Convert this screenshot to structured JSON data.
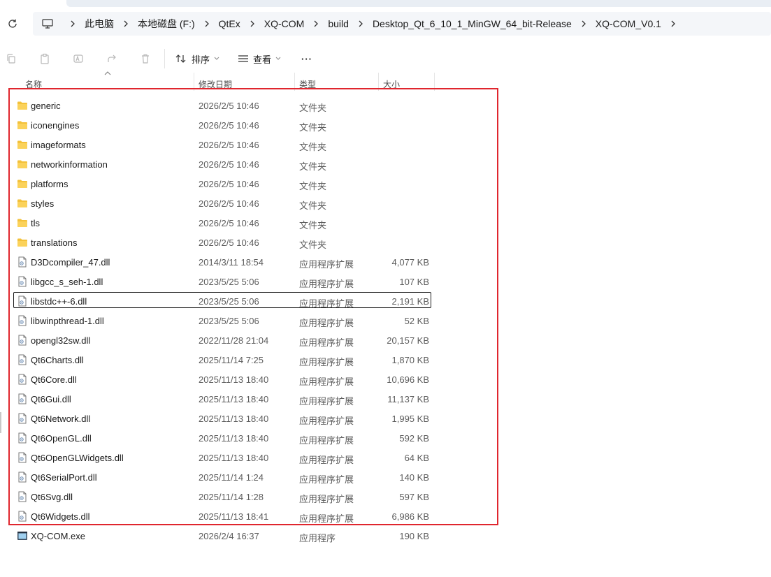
{
  "breadcrumb": [
    "此电脑",
    "本地磁盘 (F:)",
    "QtEx",
    "XQ-COM",
    "build",
    "Desktop_Qt_6_10_1_MinGW_64_bit-Release",
    "XQ-COM_V0.1"
  ],
  "toolbar": {
    "sort_label": "排序",
    "view_label": "查看",
    "more_label": "···"
  },
  "columns": {
    "name": "名称",
    "date": "修改日期",
    "type": "类型",
    "size": "大小"
  },
  "files": [
    {
      "name": "generic",
      "date": "2026/2/5 10:46",
      "type": "文件夹",
      "size": "",
      "kind": "folder"
    },
    {
      "name": "iconengines",
      "date": "2026/2/5 10:46",
      "type": "文件夹",
      "size": "",
      "kind": "folder"
    },
    {
      "name": "imageformats",
      "date": "2026/2/5 10:46",
      "type": "文件夹",
      "size": "",
      "kind": "folder"
    },
    {
      "name": "networkinformation",
      "date": "2026/2/5 10:46",
      "type": "文件夹",
      "size": "",
      "kind": "folder"
    },
    {
      "name": "platforms",
      "date": "2026/2/5 10:46",
      "type": "文件夹",
      "size": "",
      "kind": "folder"
    },
    {
      "name": "styles",
      "date": "2026/2/5 10:46",
      "type": "文件夹",
      "size": "",
      "kind": "folder"
    },
    {
      "name": "tls",
      "date": "2026/2/5 10:46",
      "type": "文件夹",
      "size": "",
      "kind": "folder"
    },
    {
      "name": "translations",
      "date": "2026/2/5 10:46",
      "type": "文件夹",
      "size": "",
      "kind": "folder"
    },
    {
      "name": "D3Dcompiler_47.dll",
      "date": "2014/3/11 18:54",
      "type": "应用程序扩展",
      "size": "4,077 KB",
      "kind": "dll"
    },
    {
      "name": "libgcc_s_seh-1.dll",
      "date": "2023/5/25 5:06",
      "type": "应用程序扩展",
      "size": "107 KB",
      "kind": "dll"
    },
    {
      "name": "libstdc++-6.dll",
      "date": "2023/5/25 5:06",
      "type": "应用程序扩展",
      "size": "2,191 KB",
      "kind": "dll",
      "focused": true
    },
    {
      "name": "libwinpthread-1.dll",
      "date": "2023/5/25 5:06",
      "type": "应用程序扩展",
      "size": "52 KB",
      "kind": "dll"
    },
    {
      "name": "opengl32sw.dll",
      "date": "2022/11/28 21:04",
      "type": "应用程序扩展",
      "size": "20,157 KB",
      "kind": "dll"
    },
    {
      "name": "Qt6Charts.dll",
      "date": "2025/11/14 7:25",
      "type": "应用程序扩展",
      "size": "1,870 KB",
      "kind": "dll"
    },
    {
      "name": "Qt6Core.dll",
      "date": "2025/11/13 18:40",
      "type": "应用程序扩展",
      "size": "10,696 KB",
      "kind": "dll"
    },
    {
      "name": "Qt6Gui.dll",
      "date": "2025/11/13 18:40",
      "type": "应用程序扩展",
      "size": "11,137 KB",
      "kind": "dll"
    },
    {
      "name": "Qt6Network.dll",
      "date": "2025/11/13 18:40",
      "type": "应用程序扩展",
      "size": "1,995 KB",
      "kind": "dll"
    },
    {
      "name": "Qt6OpenGL.dll",
      "date": "2025/11/13 18:40",
      "type": "应用程序扩展",
      "size": "592 KB",
      "kind": "dll"
    },
    {
      "name": "Qt6OpenGLWidgets.dll",
      "date": "2025/11/13 18:40",
      "type": "应用程序扩展",
      "size": "64 KB",
      "kind": "dll"
    },
    {
      "name": "Qt6SerialPort.dll",
      "date": "2025/11/14 1:24",
      "type": "应用程序扩展",
      "size": "140 KB",
      "kind": "dll"
    },
    {
      "name": "Qt6Svg.dll",
      "date": "2025/11/14 1:28",
      "type": "应用程序扩展",
      "size": "597 KB",
      "kind": "dll"
    },
    {
      "name": "Qt6Widgets.dll",
      "date": "2025/11/13 18:41",
      "type": "应用程序扩展",
      "size": "6,986 KB",
      "kind": "dll"
    },
    {
      "name": "XQ-COM.exe",
      "date": "2026/2/4 16:37",
      "type": "应用程序",
      "size": "190 KB",
      "kind": "exe"
    }
  ],
  "colors": {
    "highlight_border": "#e0262e",
    "folder": "#f3c13a",
    "address_bg": "#f4f6f9"
  }
}
